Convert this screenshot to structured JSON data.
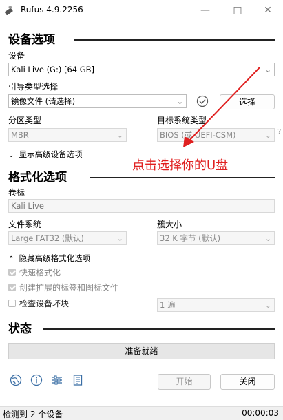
{
  "window": {
    "title": "Rufus 4.9.2256"
  },
  "sections": {
    "device_options": "设备选项",
    "format_options": "格式化选项",
    "status": "状态"
  },
  "device": {
    "label": "设备",
    "value": "Kali Live (G:) [64 GB]"
  },
  "boot": {
    "label": "引导类型选择",
    "value": "镜像文件 (请选择)",
    "select_button": "选择"
  },
  "partition": {
    "label": "分区类型",
    "value": "MBR"
  },
  "target": {
    "label": "目标系统类型",
    "value": "BIOS (或 UEFI-CSM)",
    "help": "?"
  },
  "advanced_device": {
    "label": "显示高级设备选项"
  },
  "volume": {
    "label": "卷标",
    "value": "Kali Live"
  },
  "filesystem": {
    "label": "文件系统",
    "value": "Large FAT32 (默认)"
  },
  "cluster": {
    "label": "簇大小",
    "value": "32 K 字节 (默认)"
  },
  "advanced_format": {
    "label": "隐藏高级格式化选项"
  },
  "checkboxes": {
    "quick_format": {
      "label": "快速格式化",
      "checked": true
    },
    "extended_label": {
      "label": "创建扩展的标签和图标文件",
      "checked": true
    },
    "check_bad": {
      "label": "检查设备坏块",
      "checked": false
    }
  },
  "passes": {
    "value": "1 遍"
  },
  "status": {
    "text": "准备就绪"
  },
  "buttons": {
    "start": "开始",
    "close": "关闭"
  },
  "footer": {
    "text": "检测到 2 个设备",
    "time": "00:00:03"
  },
  "annotation": {
    "text": "点击选择你的U盘",
    "color": "#e02020"
  },
  "icons": [
    "globe-icon",
    "info-icon",
    "settings-icon",
    "log-icon"
  ]
}
